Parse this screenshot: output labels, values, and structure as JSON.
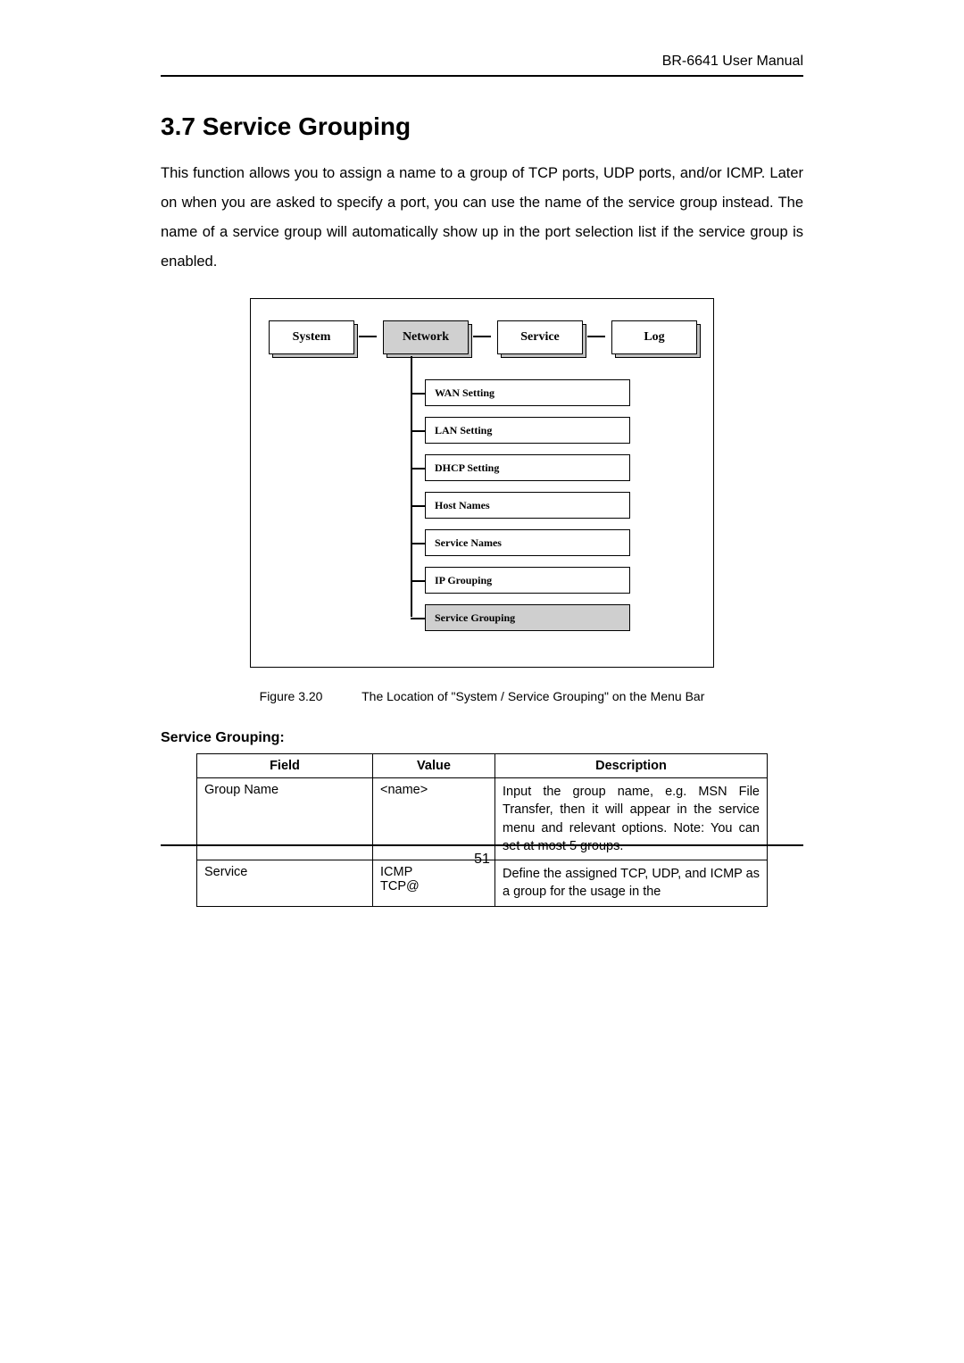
{
  "header": {
    "doc_title": "BR-6641 User Manual"
  },
  "section": {
    "number": "3.7",
    "title": "Service Grouping",
    "heading_full": "3.7   Service Grouping",
    "paragraph": "This function allows you to assign a name to a group of TCP ports, UDP ports, and/or ICMP. Later on when you are asked to specify a port, you can use the name of the service group instead. The name of a service group will automatically show up in the port selection list if the service group is enabled."
  },
  "diagram": {
    "tabs": [
      {
        "label": "System",
        "active": false
      },
      {
        "label": "Network",
        "active": true
      },
      {
        "label": "Service",
        "active": false
      },
      {
        "label": "Log",
        "active": false
      }
    ],
    "submenu": [
      {
        "label": "WAN Setting",
        "active": false
      },
      {
        "label": "LAN Setting",
        "active": false
      },
      {
        "label": "DHCP Setting",
        "active": false
      },
      {
        "label": "Host Names",
        "active": false
      },
      {
        "label": "Service Names",
        "active": false
      },
      {
        "label": "IP Grouping",
        "active": false
      },
      {
        "label": "Service Grouping",
        "active": true
      }
    ]
  },
  "figure": {
    "label": "Figure 3.20",
    "caption": "The Location of \"System / Service Grouping\" on the Menu Bar"
  },
  "table": {
    "heading": "Service Grouping:",
    "headers": {
      "field": "Field",
      "value": "Value",
      "description": "Description"
    },
    "rows": [
      {
        "field": "Group Name",
        "value": "<name>",
        "description": "Input the group name, e.g. MSN File Transfer, then it will appear in the service menu and relevant options. Note: You can set at most 5 groups."
      },
      {
        "field": "Service",
        "value": "ICMP\nTCP@",
        "description": "Define the assigned TCP, UDP, and ICMP as a group for the usage in the"
      }
    ]
  },
  "footer": {
    "page_number": "51"
  }
}
